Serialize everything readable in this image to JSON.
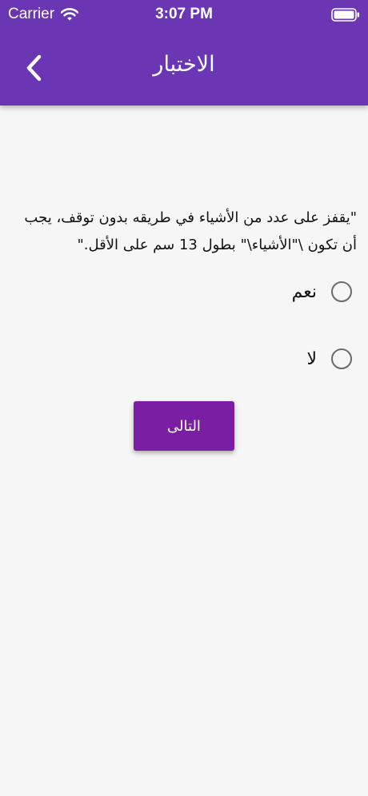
{
  "status_bar": {
    "carrier": "Carrier",
    "time": "3:07 PM",
    "wifi_icon": "wifi-icon",
    "battery_icon": "battery-icon"
  },
  "app_bar": {
    "title": "الاختبار",
    "back_icon": "chevron-left-icon",
    "background_color": "#6a36b4"
  },
  "quiz": {
    "question": "\"يقفز على عدد من الأشياء في طريقه بدون توقف، يجب أن تكون \\\"الأشياء\\\" بطول 13 سم على الأقل.\"",
    "options": [
      {
        "label": "نعم",
        "selected": false
      },
      {
        "label": "لا",
        "selected": false
      }
    ],
    "next_label": "التالى",
    "next_button_color": "#7a1fa3"
  }
}
